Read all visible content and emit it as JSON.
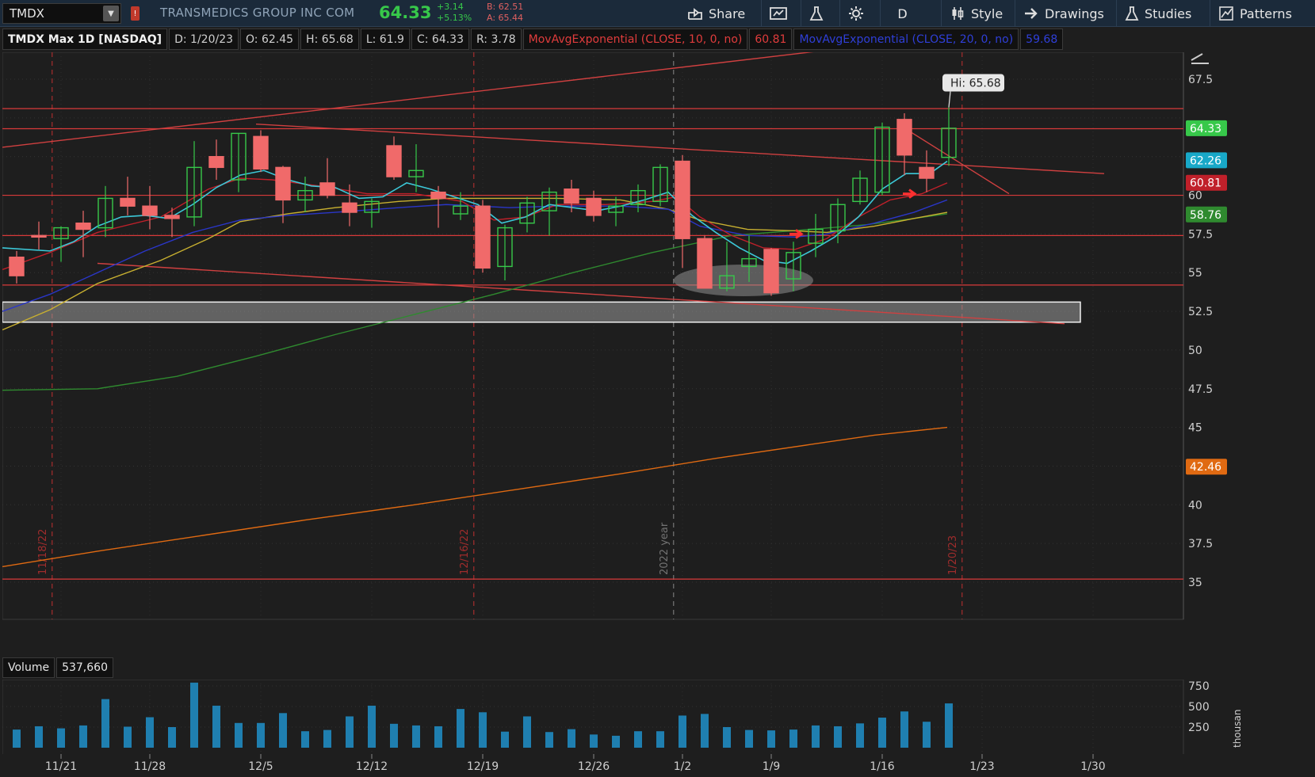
{
  "toolbar": {
    "symbol": "TMDX",
    "company": "TRANSMEDICS GROUP INC COM",
    "last": "64.33",
    "change": "+3.14",
    "change_pct": "+5.13%",
    "bid": "B: 62.51",
    "ask": "A: 65.44",
    "share_label": "Share",
    "period_label": "D",
    "style_label": "Style",
    "drawings_label": "Drawings",
    "studies_label": "Studies",
    "patterns_label": "Patterns"
  },
  "infobar": {
    "title": "TMDX Max 1D [NASDAQ]",
    "date": "D: 1/20/23",
    "open": "O: 62.45",
    "high": "H: 65.68",
    "low": "L: 61.9",
    "close": "C: 64.33",
    "range": "R: 3.78",
    "ema10_label": "MovAvgExponential (CLOSE, 10, 0, no)",
    "ema10_value": "60.81",
    "ema20_label": "MovAvgExponential (CLOSE, 20, 0, no)",
    "ema20_value": "59.68"
  },
  "volume": {
    "label": "Volume",
    "value": "537,660",
    "unit": "thousan"
  },
  "colors": {
    "up": "#37c84a",
    "down": "#f06a6a",
    "ema10": "#c0202a",
    "ema20": "#2a36c8",
    "ema_cyan": "#3cc8d8",
    "ema_yellow": "#c8b030",
    "ma_green": "#2f8a2f",
    "ma_orange": "#e06a12",
    "volume": "#1f7fb0",
    "hline": "#d83a3a"
  },
  "chart_data": {
    "type": "candlestick",
    "ylim": [
      32.5,
      70
    ],
    "yticks": [
      35,
      37.5,
      40,
      42.5,
      45,
      47.5,
      50,
      52.5,
      55,
      57.5,
      60,
      62.5,
      65,
      67.5
    ],
    "ytick_labels": [
      "35",
      "37.5",
      "40",
      "",
      "45",
      "47.5",
      "50",
      "52.5",
      "55",
      "57.5",
      "60",
      "",
      "",
      "67.5"
    ],
    "xtick_labels": [
      "11/21",
      "11/28",
      "12/5",
      "12/12",
      "12/19",
      "12/26",
      "1/2",
      "1/9",
      "1/16",
      "1/23",
      "1/30"
    ],
    "vertical_labels": [
      "11/18/22",
      "12/16/22",
      "2022 year",
      "1/20/23"
    ],
    "hi_label": "Hi: 65.68",
    "price_badges": [
      {
        "value": "64.33",
        "color": "#37c84a"
      },
      {
        "value": "62.26",
        "color": "#18a8c8"
      },
      {
        "value": "60.81",
        "color": "#c0202a"
      },
      {
        "value": "58.76",
        "color": "#2f8a2f"
      },
      {
        "value": "42.46",
        "color": "#e06a12"
      }
    ],
    "candles": [
      {
        "d": "11/17",
        "o": 56.0,
        "h": 56.4,
        "l": 54.3,
        "c": 54.8
      },
      {
        "d": "11/18",
        "o": 57.4,
        "h": 58.3,
        "l": 56.5,
        "c": 57.3
      },
      {
        "d": "11/21",
        "o": 57.2,
        "h": 58.0,
        "l": 55.7,
        "c": 57.9
      },
      {
        "d": "11/22",
        "o": 58.2,
        "h": 59.0,
        "l": 56.0,
        "c": 57.8
      },
      {
        "d": "11/23",
        "o": 57.9,
        "h": 60.6,
        "l": 57.3,
        "c": 59.8
      },
      {
        "d": "11/25",
        "o": 59.8,
        "h": 61.2,
        "l": 58.7,
        "c": 59.3
      },
      {
        "d": "11/28",
        "o": 59.3,
        "h": 60.6,
        "l": 57.8,
        "c": 58.7
      },
      {
        "d": "11/29",
        "o": 58.7,
        "h": 59.2,
        "l": 57.3,
        "c": 58.5
      },
      {
        "d": "11/30",
        "o": 58.6,
        "h": 63.5,
        "l": 58.0,
        "c": 61.8
      },
      {
        "d": "12/1",
        "o": 62.5,
        "h": 63.6,
        "l": 61.0,
        "c": 61.8
      },
      {
        "d": "12/2",
        "o": 61.0,
        "h": 64.0,
        "l": 60.2,
        "c": 64.0
      },
      {
        "d": "12/5",
        "o": 63.8,
        "h": 64.2,
        "l": 61.5,
        "c": 61.7
      },
      {
        "d": "12/6",
        "o": 61.8,
        "h": 61.9,
        "l": 58.2,
        "c": 59.7
      },
      {
        "d": "12/7",
        "o": 59.7,
        "h": 61.2,
        "l": 58.9,
        "c": 60.3
      },
      {
        "d": "12/8",
        "o": 60.8,
        "h": 62.4,
        "l": 59.8,
        "c": 60.0
      },
      {
        "d": "12/9",
        "o": 59.5,
        "h": 60.7,
        "l": 58.0,
        "c": 58.9
      },
      {
        "d": "12/12",
        "o": 58.9,
        "h": 59.8,
        "l": 57.9,
        "c": 59.6
      },
      {
        "d": "12/13",
        "o": 63.2,
        "h": 63.8,
        "l": 61.0,
        "c": 61.2
      },
      {
        "d": "12/14",
        "o": 61.2,
        "h": 63.3,
        "l": 60.2,
        "c": 61.6
      },
      {
        "d": "12/15",
        "o": 60.2,
        "h": 60.6,
        "l": 57.9,
        "c": 59.8
      },
      {
        "d": "12/16",
        "o": 58.8,
        "h": 60.2,
        "l": 58.4,
        "c": 59.3
      },
      {
        "d": "12/19",
        "o": 59.3,
        "h": 59.7,
        "l": 55.0,
        "c": 55.3
      },
      {
        "d": "12/20",
        "o": 55.4,
        "h": 58.1,
        "l": 54.5,
        "c": 57.9
      },
      {
        "d": "12/21",
        "o": 58.2,
        "h": 59.9,
        "l": 57.6,
        "c": 59.5
      },
      {
        "d": "12/22",
        "o": 59.0,
        "h": 60.5,
        "l": 57.4,
        "c": 60.2
      },
      {
        "d": "12/23",
        "o": 60.4,
        "h": 61.0,
        "l": 58.9,
        "c": 59.5
      },
      {
        "d": "12/27",
        "o": 59.8,
        "h": 60.3,
        "l": 58.3,
        "c": 58.7
      },
      {
        "d": "12/28",
        "o": 58.9,
        "h": 59.9,
        "l": 58.0,
        "c": 59.3
      },
      {
        "d": "12/29",
        "o": 59.4,
        "h": 60.7,
        "l": 58.9,
        "c": 60.3
      },
      {
        "d": "12/30",
        "o": 59.6,
        "h": 62.0,
        "l": 59.3,
        "c": 61.8
      },
      {
        "d": "1/3",
        "o": 62.2,
        "h": 62.6,
        "l": 55.3,
        "c": 57.2
      },
      {
        "d": "1/4",
        "o": 57.2,
        "h": 57.4,
        "l": 54.3,
        "c": 54.0
      },
      {
        "d": "1/5",
        "o": 54.0,
        "h": 57.0,
        "l": 53.8,
        "c": 54.8
      },
      {
        "d": "1/6",
        "o": 55.4,
        "h": 57.4,
        "l": 54.4,
        "c": 55.9
      },
      {
        "d": "1/9",
        "o": 56.5,
        "h": 56.6,
        "l": 53.5,
        "c": 53.7
      },
      {
        "d": "1/10",
        "o": 54.6,
        "h": 57.0,
        "l": 53.8,
        "c": 56.3
      },
      {
        "d": "1/11",
        "o": 56.9,
        "h": 58.8,
        "l": 56.0,
        "c": 57.8
      },
      {
        "d": "1/12",
        "o": 57.7,
        "h": 59.8,
        "l": 56.9,
        "c": 59.4
      },
      {
        "d": "1/13",
        "o": 59.6,
        "h": 61.6,
        "l": 59.4,
        "c": 61.1
      },
      {
        "d": "1/17",
        "o": 60.2,
        "h": 64.7,
        "l": 60.0,
        "c": 64.4
      },
      {
        "d": "1/18",
        "o": 64.9,
        "h": 65.3,
        "l": 61.3,
        "c": 62.6
      },
      {
        "d": "1/19",
        "o": 61.8,
        "h": 62.9,
        "l": 60.2,
        "c": 61.1
      },
      {
        "d": "1/20",
        "o": 62.45,
        "h": 65.68,
        "l": 61.9,
        "c": 64.33
      }
    ],
    "volume_yticks": [
      "750",
      "500",
      "250"
    ],
    "volume": [
      220,
      260,
      235,
      270,
      590,
      255,
      370,
      250,
      790,
      510,
      300,
      300,
      420,
      200,
      215,
      380,
      510,
      290,
      270,
      260,
      470,
      430,
      195,
      380,
      190,
      225,
      160,
      145,
      200,
      200,
      390,
      410,
      250,
      215,
      210,
      220,
      270,
      260,
      295,
      365,
      440,
      315,
      537.66
    ]
  }
}
